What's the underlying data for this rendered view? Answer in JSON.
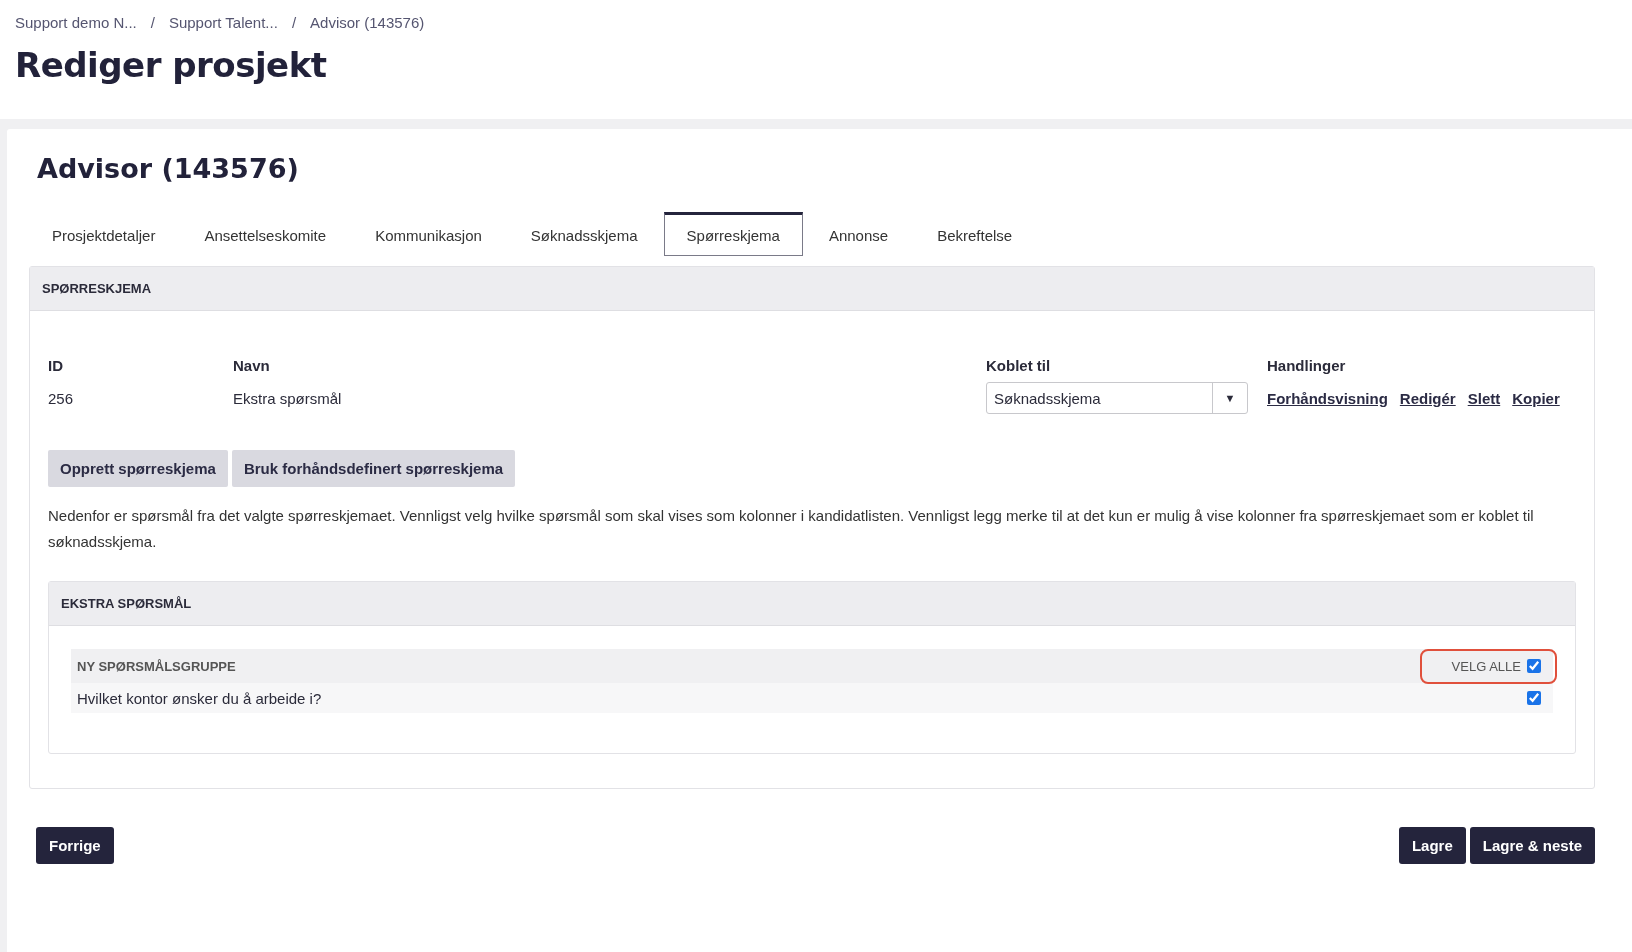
{
  "breadcrumbs": [
    "Support demo N...",
    "Support Talent...",
    "Advisor (143576)"
  ],
  "breadcrumb_separator": "/",
  "page_title": "Rediger prosjekt",
  "project_title": "Advisor (143576)",
  "tabs": [
    {
      "label": "Prosjektdetaljer",
      "selected": false
    },
    {
      "label": "Ansettelseskomite",
      "selected": false
    },
    {
      "label": "Kommunikasjon",
      "selected": false
    },
    {
      "label": "Søknadsskjema",
      "selected": false
    },
    {
      "label": "Spørreskjema",
      "selected": true
    },
    {
      "label": "Annonse",
      "selected": false
    },
    {
      "label": "Bekreftelse",
      "selected": false
    }
  ],
  "section": {
    "title": "SPØRRESKJEMA",
    "columns": [
      "ID",
      "Navn",
      "Koblet til",
      "Handlinger"
    ],
    "row": {
      "id": "256",
      "name": "Ekstra spørsmål",
      "linked_to": "Søknadsskjema",
      "dropdown_arrow": "▼",
      "actions": [
        "Forhåndsvisning",
        "Redigér",
        "Slett",
        "Kopier"
      ]
    },
    "buttons": [
      "Opprett spørreskjema",
      "Bruk forhåndsdefinert spørreskjema"
    ],
    "description": "Nedenfor er spørsmål fra det valgte spørreskjemaet. Vennligst velg hvilke spørsmål som skal vises som kolonner i kandidatlisten. Vennligst legg merke til at det kun er mulig å vise kolonner fra spørreskjemaet som er koblet til søknadsskjema.",
    "question_panel": {
      "title": "EKSTRA SPØRSMÅL",
      "group": {
        "title": "NY SPØRSMÅLSGRUPPE",
        "select_all_label": "VELG ALLE",
        "select_all_checked": true,
        "highlighted": true
      },
      "questions": [
        {
          "text": "Hvilket kontor ønsker du å arbeide i?",
          "checked": true
        }
      ]
    }
  },
  "footer": {
    "left_buttons": [
      "Forrige"
    ],
    "right_buttons": [
      "Lagre",
      "Lagre & neste"
    ]
  }
}
